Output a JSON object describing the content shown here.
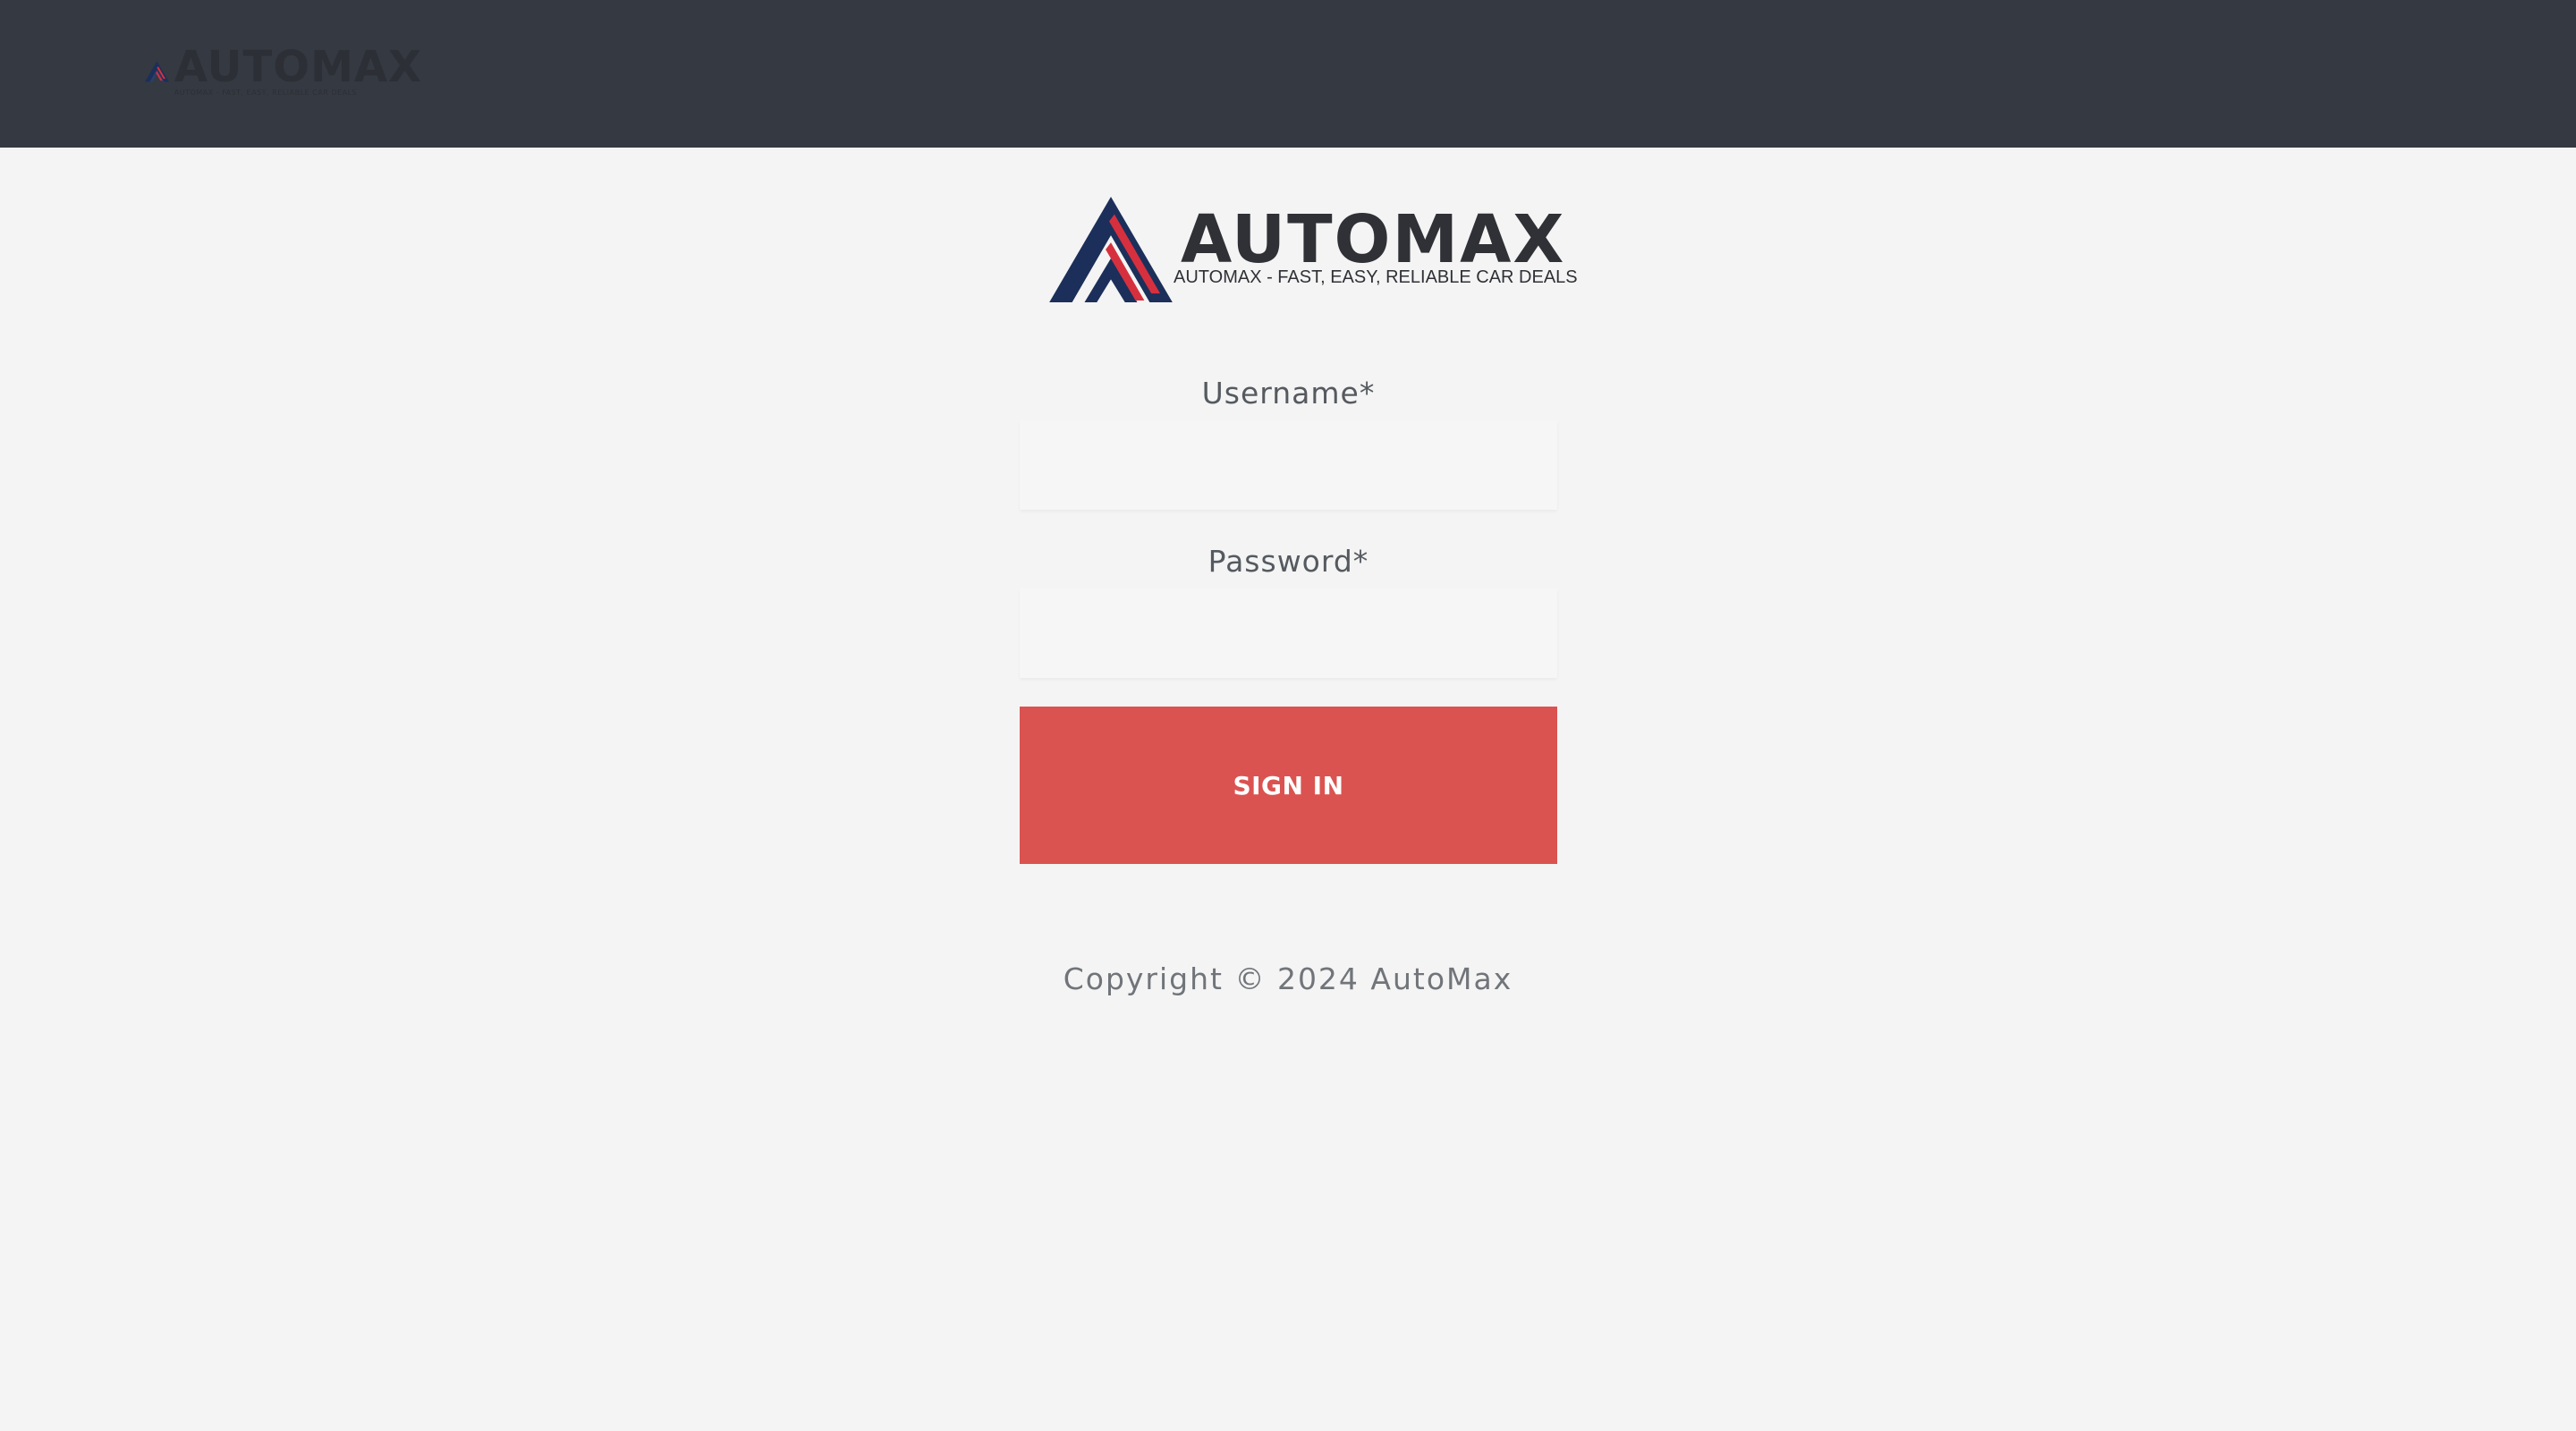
{
  "brand": {
    "name": "AUTOMAX",
    "tagline": "AUTOMAX - FAST, EASY, RELIABLE CAR DEALS",
    "colors": {
      "navy": "#1b2f5a",
      "red": "#d6303f",
      "topbar": "#353942",
      "button": "#da5350"
    }
  },
  "header": {
    "logo_icon": "automax-logo-icon"
  },
  "login": {
    "username_label": "Username*",
    "username_value": "",
    "password_label": "Password*",
    "password_value": "",
    "submit_label": "SIGN IN"
  },
  "footer": {
    "copyright": "Copyright © 2024 AutoMax"
  }
}
